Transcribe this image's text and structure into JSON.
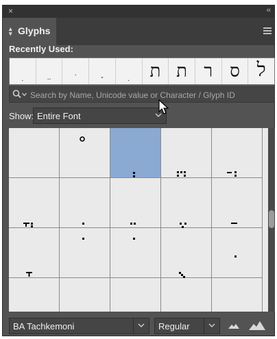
{
  "panel": {
    "title": "Glyphs",
    "recently_used_label": "Recently Used:",
    "recent_glyphs": [
      ".",
      "..",
      ".",
      "-",
      ".",
      "ת",
      "ת",
      "ר",
      "ס",
      "ל"
    ]
  },
  "search": {
    "placeholder": "Search by Name, Unicode value or Character / Glyph ID",
    "value": ""
  },
  "show": {
    "label": "Show:",
    "value": "Entire Font"
  },
  "font": {
    "family": "BA Tachkemoni",
    "style": "Regular"
  },
  "icons": {
    "close": "close-x-icon",
    "collapse": "double-chevron-icon",
    "menu": "hamburger-menu-icon",
    "search": "magnifier-icon",
    "zoom_out": "small-mountains-icon",
    "zoom_in": "large-mountains-icon"
  },
  "colors": {
    "panel_bg": "#535353",
    "selected_cell": "#8aa9d3",
    "cell_bg": "#eaeaea"
  }
}
